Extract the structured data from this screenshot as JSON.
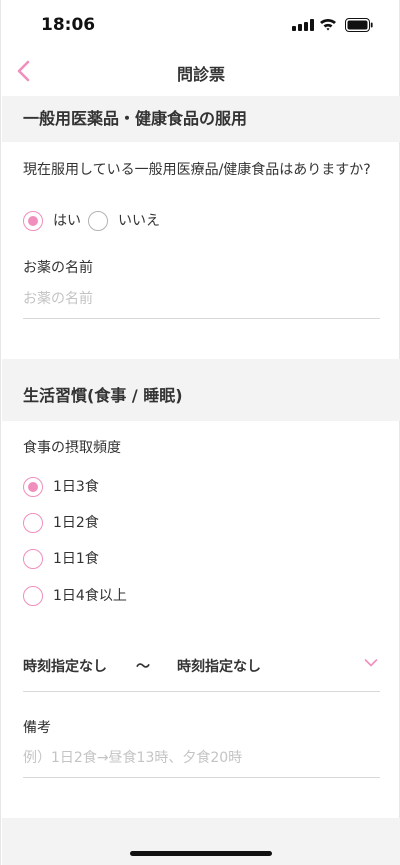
{
  "status_bar": {
    "time": "18:06",
    "icons": [
      "signal-icon",
      "wifi-icon",
      "battery-icon"
    ]
  },
  "nav": {
    "back_icon": "chevron-left-icon",
    "title": "問診票"
  },
  "section_otc": {
    "title": "一般用医薬品・健康食品の服用",
    "question": "現在服用している一般用医療品/健康食品はありますか?",
    "options": [
      {
        "label": "はい",
        "selected": true
      },
      {
        "label": "いいえ",
        "selected": false
      }
    ],
    "medicine_name": {
      "label": "お薬の名前",
      "placeholder": "お薬の名前"
    }
  },
  "section_lifestyle": {
    "title": "生活習慣(食事 / 睡眠)",
    "meal_frequency": {
      "label": "食事の摂取頻度",
      "options": [
        {
          "label": "1日3食",
          "selected": true
        },
        {
          "label": "1日2食",
          "selected": false
        },
        {
          "label": "1日1食",
          "selected": false
        },
        {
          "label": "1日4食以上",
          "selected": false
        }
      ]
    },
    "time_range": {
      "from": "時刻指定なし",
      "separator": "〜",
      "to": "時刻指定なし"
    },
    "notes": {
      "label": "備考",
      "placeholder": "例）1日2食→昼食13時、夕食20時"
    }
  },
  "colors": {
    "accent": "#f08fbd",
    "section_bg": "#f3f3f3",
    "placeholder": "#c4c4c4"
  }
}
